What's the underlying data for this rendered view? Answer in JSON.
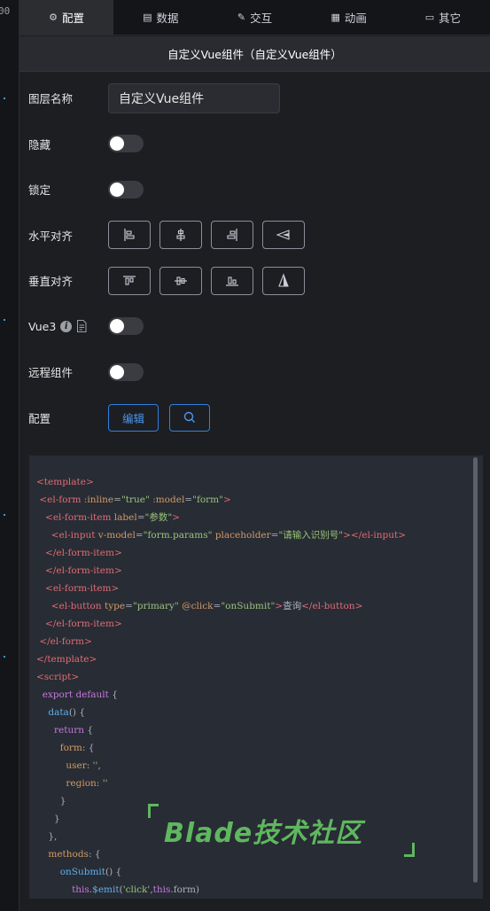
{
  "canvas": {
    "ruler_text": "00"
  },
  "tabs": [
    {
      "label": "配置",
      "icon": "gear-icon",
      "active": true
    },
    {
      "label": "数据",
      "icon": "database-icon",
      "active": false
    },
    {
      "label": "交互",
      "icon": "edit-icon",
      "active": false
    },
    {
      "label": "动画",
      "icon": "film-icon",
      "active": false
    },
    {
      "label": "其它",
      "icon": "folder-icon",
      "active": false
    }
  ],
  "section_title": "自定义Vue组件（自定义Vue组件）",
  "form": {
    "layer_name_label": "图层名称",
    "layer_name_value": "自定义Vue组件",
    "hidden_label": "隐藏",
    "locked_label": "锁定",
    "h_align_label": "水平对齐",
    "v_align_label": "垂直对齐",
    "vue3_label": "Vue3",
    "remote_label": "远程组件",
    "config_label": "配置",
    "edit_button": "编辑",
    "search_icon": "search-icon",
    "switches": {
      "hidden": false,
      "locked": false,
      "vue3": false,
      "remote": false
    }
  },
  "code_lines": [
    [
      [
        "t-tag",
        "<template>"
      ]
    ],
    [
      [
        "t-txt",
        " "
      ],
      [
        "t-tag",
        "<el-form"
      ],
      [
        "t-txt",
        " "
      ],
      [
        "t-attr",
        ":inline"
      ],
      [
        "t-txt",
        "="
      ],
      [
        "t-str",
        "\"true\""
      ],
      [
        "t-txt",
        " "
      ],
      [
        "t-attr",
        ":model"
      ],
      [
        "t-txt",
        "="
      ],
      [
        "t-str",
        "\"form\""
      ],
      [
        "t-tag",
        ">"
      ]
    ],
    [
      [
        "t-txt",
        "   "
      ],
      [
        "t-tag",
        "<el-form-item"
      ],
      [
        "t-txt",
        " "
      ],
      [
        "t-attr",
        "label"
      ],
      [
        "t-txt",
        "="
      ],
      [
        "t-str",
        "\"参数\""
      ],
      [
        "t-tag",
        ">"
      ]
    ],
    [
      [
        "t-txt",
        "     "
      ],
      [
        "t-tag",
        "<el-input"
      ],
      [
        "t-txt",
        " "
      ],
      [
        "t-attr",
        "v-model"
      ],
      [
        "t-txt",
        "="
      ],
      [
        "t-str",
        "\"form.params\""
      ],
      [
        "t-txt",
        " "
      ],
      [
        "t-attr",
        "placeholder"
      ],
      [
        "t-txt",
        "="
      ],
      [
        "t-str",
        "\"请输入识别号\""
      ],
      [
        "t-tag",
        "></el-input>"
      ]
    ],
    [
      [
        "t-txt",
        "   "
      ],
      [
        "t-tag",
        "</el-form-item>"
      ]
    ],
    [
      [
        "t-txt",
        "   "
      ],
      [
        "t-tag",
        "</el-form-item>"
      ]
    ],
    [
      [
        "t-txt",
        "   "
      ],
      [
        "t-tag",
        "<el-form-item>"
      ]
    ],
    [
      [
        "t-txt",
        "     "
      ],
      [
        "t-tag",
        "<el-button"
      ],
      [
        "t-txt",
        " "
      ],
      [
        "t-attr",
        "type"
      ],
      [
        "t-txt",
        "="
      ],
      [
        "t-str",
        "\"primary\""
      ],
      [
        "t-txt",
        " "
      ],
      [
        "t-attr",
        "@click"
      ],
      [
        "t-txt",
        "="
      ],
      [
        "t-str",
        "\"onSubmit\""
      ],
      [
        "t-tag",
        ">"
      ],
      [
        "t-txt",
        "查询"
      ],
      [
        "t-tag",
        "</el-button>"
      ]
    ],
    [
      [
        "t-txt",
        "   "
      ],
      [
        "t-tag",
        "</el-form-item>"
      ]
    ],
    [
      [
        "t-txt",
        " "
      ],
      [
        "t-tag",
        "</el-form>"
      ]
    ],
    [
      [
        "t-tag",
        "</template>"
      ]
    ],
    [
      [
        "t-tag",
        "<script>"
      ]
    ],
    [
      [
        "t-txt",
        "  "
      ],
      [
        "t-kw",
        "export default"
      ],
      [
        "t-txt",
        " {"
      ]
    ],
    [
      [
        "t-txt",
        "    "
      ],
      [
        "t-fn",
        "data"
      ],
      [
        "t-txt",
        "() {"
      ]
    ],
    [
      [
        "t-txt",
        "      "
      ],
      [
        "t-kw",
        "return"
      ],
      [
        "t-txt",
        " {"
      ]
    ],
    [
      [
        "t-txt",
        "        "
      ],
      [
        "t-attr",
        "form"
      ],
      [
        "t-txt",
        ": {"
      ]
    ],
    [
      [
        "t-txt",
        "          "
      ],
      [
        "t-attr",
        "user"
      ],
      [
        "t-txt",
        ": "
      ],
      [
        "t-str",
        "''"
      ],
      [
        "t-txt",
        ","
      ]
    ],
    [
      [
        "t-txt",
        "          "
      ],
      [
        "t-attr",
        "region"
      ],
      [
        "t-txt",
        ": "
      ],
      [
        "t-str",
        "''"
      ]
    ],
    [
      [
        "t-txt",
        "        }"
      ]
    ],
    [
      [
        "t-txt",
        "      }"
      ]
    ],
    [
      [
        "t-txt",
        "    },"
      ]
    ],
    [
      [
        "t-txt",
        "    "
      ],
      [
        "t-attr",
        "methods"
      ],
      [
        "t-txt",
        ": {"
      ]
    ],
    [
      [
        "t-txt",
        "        "
      ],
      [
        "t-fn",
        "onSubmit"
      ],
      [
        "t-txt",
        "() {"
      ]
    ],
    [
      [
        "t-txt",
        "            "
      ],
      [
        "t-kw",
        "this"
      ],
      [
        "t-txt",
        "."
      ],
      [
        "t-fn",
        "$emit"
      ],
      [
        "t-txt",
        "("
      ],
      [
        "t-str",
        "'click'"
      ],
      [
        "t-txt",
        ","
      ],
      [
        "t-kw",
        "this"
      ],
      [
        "t-txt",
        ".form)"
      ]
    ]
  ],
  "watermark": "Blade技术社区"
}
